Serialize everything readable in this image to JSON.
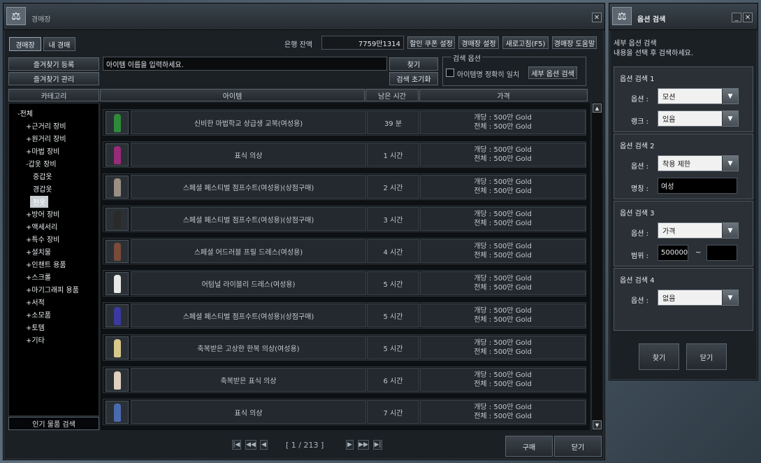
{
  "main": {
    "title": "경매장",
    "tabs": [
      "경매장",
      "내 경매"
    ],
    "bank_label": "은행 잔액",
    "bank_value": "7759만1314",
    "top_buttons": [
      "할인 쿠폰 설정",
      "경매장 설정",
      "새로고침(F5)",
      "경매장 도움말"
    ],
    "fav_add": "즐겨찾기 등록",
    "fav_manage": "즐겨찾기 관리",
    "search_placeholder": "아이템 이름을 입력하세요.",
    "find_btn": "찾기",
    "reset_btn": "검색 초기화",
    "search_option_title": "검색 옵션",
    "exact_match": "아이템명 정확히 일치",
    "detail_option": "세부 옵션 검색",
    "col_category": "카테고리",
    "col_item": "아이템",
    "col_time": "남은 시간",
    "col_price": "가격",
    "popular_btn": "인기 물품 검색",
    "pager_text": "[ 1 / 213 ]",
    "buy_btn": "구매",
    "close_btn": "닫기"
  },
  "tree": [
    {
      "label": "-전체",
      "level": 0
    },
    {
      "label": "+근거리 장비",
      "level": 1
    },
    {
      "label": "+원거리 장비",
      "level": 1
    },
    {
      "label": "+마법 장비",
      "level": 1
    },
    {
      "label": "-갑옷 장비",
      "level": 1
    },
    {
      "label": "중갑옷",
      "level": 2
    },
    {
      "label": "경갑옷",
      "level": 2
    },
    {
      "label": "천옷",
      "level": 2,
      "selected": true
    },
    {
      "label": "+방어 장비",
      "level": 1
    },
    {
      "label": "+액세서리",
      "level": 1
    },
    {
      "label": "+특수 장비",
      "level": 1
    },
    {
      "label": "+설치물",
      "level": 1
    },
    {
      "label": "+인챈트 용품",
      "level": 1
    },
    {
      "label": "+스크롤",
      "level": 1
    },
    {
      "label": "+마기그래피 용품",
      "level": 1
    },
    {
      "label": "+서적",
      "level": 1
    },
    {
      "label": "+소모품",
      "level": 1
    },
    {
      "label": "+토템",
      "level": 1
    },
    {
      "label": "+기타",
      "level": 1
    }
  ],
  "items": [
    {
      "name": "신비한 마법학교 상급생 교복(여성용)",
      "time": "39 분",
      "unit": "개당 : 500만 Gold",
      "total": "전체 : 500만 Gold",
      "color": "#2e8b3a"
    },
    {
      "name": "표식 의상",
      "time": "1 시간",
      "unit": "개당 : 500만 Gold",
      "total": "전체 : 500만 Gold",
      "color": "#9a2a7a"
    },
    {
      "name": "스페셜 페스티벌 점프수트(여성용)(상점구매)",
      "time": "2 시간",
      "unit": "개당 : 500만 Gold",
      "total": "전체 : 500만 Gold",
      "color": "#9a8f82"
    },
    {
      "name": "스페셜 페스티벌 점프수트(여성용)(상점구매)",
      "time": "3 시간",
      "unit": "개당 : 500만 Gold",
      "total": "전체 : 500만 Gold",
      "color": "#2a2a2a"
    },
    {
      "name": "스페셜 어드러블 프릴 드레스(여성용)",
      "time": "4 시간",
      "unit": "개당 : 500만 Gold",
      "total": "전체 : 500만 Gold",
      "color": "#7a4a3a"
    },
    {
      "name": "어텀널 라이블리 드레스(여성용)",
      "time": "5 시간",
      "unit": "개당 : 500만 Gold",
      "total": "전체 : 500만 Gold",
      "color": "#e8e8e8"
    },
    {
      "name": "스페셜 페스티벌 점프수트(여성용)(상점구매)",
      "time": "5 시간",
      "unit": "개당 : 500만 Gold",
      "total": "전체 : 500만 Gold",
      "color": "#3a3aa0"
    },
    {
      "name": "축복받은 고상한 한복 의상(여성용)",
      "time": "5 시간",
      "unit": "개당 : 500만 Gold",
      "total": "전체 : 500만 Gold",
      "color": "#d8c88a"
    },
    {
      "name": "축복받은 표식 의상",
      "time": "6 시간",
      "unit": "개당 : 500만 Gold",
      "total": "전체 : 500만 Gold",
      "color": "#e0d0c0"
    },
    {
      "name": "표식 의상",
      "time": "7 시간",
      "unit": "개당 : 500만 Gold",
      "total": "전체 : 500만 Gold",
      "color": "#4a6ab0"
    }
  ],
  "side": {
    "title": "옵션 검색",
    "desc1": "세부 옵션 검색",
    "desc2": "내용을 선택 후 검색하세요.",
    "groups": [
      {
        "title": "옵션 검색 1",
        "rows": [
          {
            "label": "옵션 :",
            "value": "모션",
            "dd": true
          },
          {
            "label": "랭크 :",
            "value": "있음",
            "dd": true
          }
        ]
      },
      {
        "title": "옵션 검색 2",
        "rows": [
          {
            "label": "옵션 :",
            "value": "착용 제한",
            "dd": true
          },
          {
            "label": "명칭 :",
            "value": "여성",
            "dd": false
          }
        ]
      },
      {
        "title": "옵션 검색 3",
        "rows": [
          {
            "label": "옵션 :",
            "value": "가격",
            "dd": true
          },
          {
            "label": "범위 :",
            "value": "500000",
            "dd": false,
            "range": true,
            "sep": "~",
            "value2": ""
          }
        ]
      },
      {
        "title": "옵션 검색 4",
        "rows": [
          {
            "label": "옵션 :",
            "value": "없음",
            "dd": true
          }
        ]
      }
    ],
    "find_btn": "찾기",
    "close_btn": "닫기"
  }
}
